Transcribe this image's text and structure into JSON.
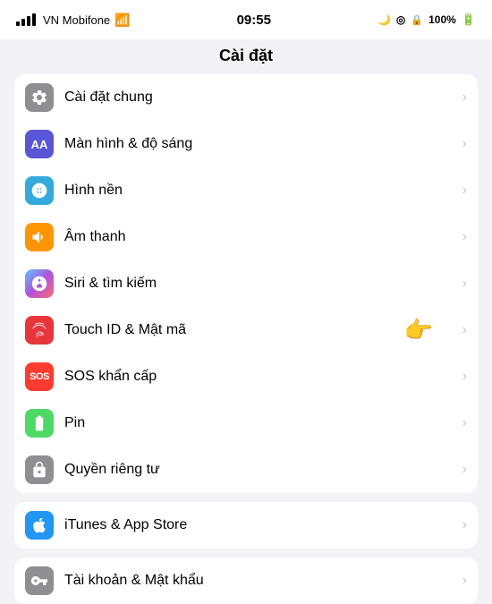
{
  "statusBar": {
    "carrier": "VN Mobifone",
    "time": "09:55",
    "battery": "100%"
  },
  "pageTitle": "Cài đặt",
  "sections": [
    {
      "items": [
        {
          "id": "cai-dat-chung",
          "label": "Cài đặt chung",
          "iconType": "gear",
          "iconBg": "gray"
        },
        {
          "id": "man-hinh",
          "label": "Màn hình & độ sáng",
          "iconType": "aa",
          "iconBg": "blue-aa"
        },
        {
          "id": "hinh-nen",
          "label": "Hình nền",
          "iconType": "flower",
          "iconBg": "teal"
        },
        {
          "id": "am-thanh",
          "label": "Âm thanh",
          "iconType": "sound",
          "iconBg": "orange"
        },
        {
          "id": "siri",
          "label": "Siri & tìm kiếm",
          "iconType": "siri",
          "iconBg": "purple-siri"
        },
        {
          "id": "touch-id",
          "label": "Touch ID & Mật mã",
          "iconType": "fingerprint",
          "iconBg": "red",
          "hasPointer": true
        },
        {
          "id": "sos",
          "label": "SOS khẩn cấp",
          "iconType": "sos",
          "iconBg": "orange-sos"
        },
        {
          "id": "pin",
          "label": "Pin",
          "iconType": "battery",
          "iconBg": "green"
        },
        {
          "id": "quyen-rieng-tu",
          "label": "Quyền riêng tư",
          "iconType": "hand",
          "iconBg": "gray-privacy"
        }
      ]
    },
    {
      "items": [
        {
          "id": "itunes",
          "label": "iTunes & App Store",
          "iconType": "app-store",
          "iconBg": "blue-itunes"
        }
      ]
    },
    {
      "items": [
        {
          "id": "tai-khoan",
          "label": "Tài khoản & Mật khẩu",
          "iconType": "key",
          "iconBg": "gray-key"
        }
      ]
    }
  ]
}
